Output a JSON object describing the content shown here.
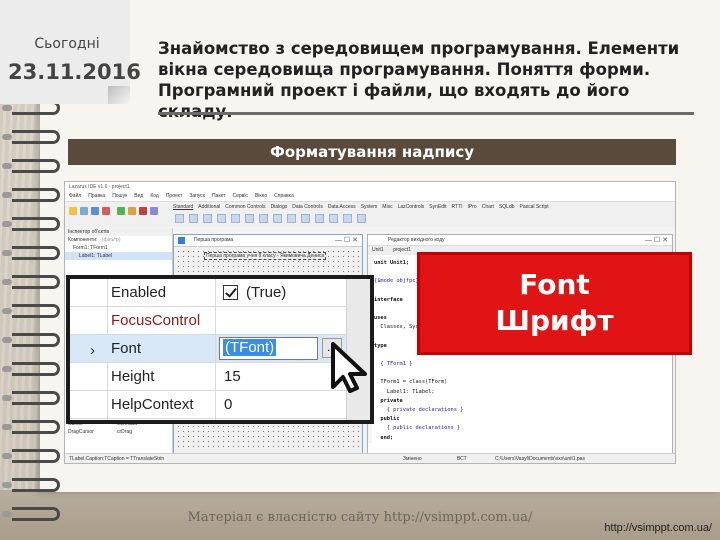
{
  "slide": {
    "today_label": "Сьогодні",
    "date": "23.11.2016",
    "heading": "Знайомство з середовищем програмування. Елементи вікна середовища програмування. Поняття форми. Програмний проект і файли, що входять до його складу.",
    "banner": "Форматування надпису",
    "callout_line1": "Font",
    "callout_line2": "Шрифт",
    "watermark": "Матеріал є власністю сайту http://vsimppt.com.ua/",
    "site_url": "http://vsimppt.com.ua/"
  },
  "ide": {
    "title": "Lazarus IDE v1.6 - project1",
    "menu": [
      "Файл",
      "Правка",
      "Пошук",
      "Вид",
      "Код",
      "Проект",
      "Запуск",
      "Пакет",
      "Сервіс",
      "Вікно",
      "Справка"
    ],
    "component_tabs": [
      "Standard",
      "Additional",
      "Common Controls",
      "Dialogs",
      "Data Controls",
      "Data Access",
      "System",
      "Misc",
      "LazControls",
      "SynEdit",
      "RTTI",
      "IPro",
      "Chart",
      "SQLdb",
      "Pascal Script"
    ],
    "inspector": {
      "title": "Інспектор об'єктів",
      "filter_label": "Компоненти:",
      "filter_placeholder": "(фільтр)",
      "tree": [
        "Form1: TForm1",
        "Label1: TLabel"
      ],
      "bottom_rows": [
        {
          "name": "Cursor",
          "value": "crDefault"
        },
        {
          "name": "DragCursor",
          "value": "crDrag"
        }
      ]
    },
    "form": {
      "title": "Перша програма",
      "label_text": "Перша програма учня 8 класу - Якимовича Дениса"
    },
    "editor": {
      "title": "Редактор вихідного коду",
      "tab": "Unit1",
      "tab_project": "project1",
      "code": [
        {
          "t": "unit Unit1;",
          "k": "kw"
        },
        {
          "t": "",
          "k": ""
        },
        {
          "t": "{$mode objfpc}{$H+}",
          "k": "cm"
        },
        {
          "t": "",
          "k": ""
        },
        {
          "t": "interface",
          "k": "kw"
        },
        {
          "t": "",
          "k": ""
        },
        {
          "t": "uses",
          "k": "kw"
        },
        {
          "t": "  Classes, SysUtils, FileUtil, Forms, Controls, Graphics, Dialogs, StdCtrls;",
          "k": ""
        },
        {
          "t": "",
          "k": ""
        },
        {
          "t": "type",
          "k": "kw"
        },
        {
          "t": "",
          "k": ""
        },
        {
          "t": "  { TForm1 }",
          "k": "cm"
        },
        {
          "t": "",
          "k": ""
        },
        {
          "t": "  TForm1 = class(TForm)",
          "k": ""
        },
        {
          "t": "    Label1: TLabel;",
          "k": ""
        },
        {
          "t": "  private",
          "k": "kw"
        },
        {
          "t": "    { private declarations }",
          "k": "cm"
        },
        {
          "t": "  public",
          "k": "kw"
        },
        {
          "t": "    { public declarations }",
          "k": "cm"
        },
        {
          "t": "  end;",
          "k": "kw"
        },
        {
          "t": "",
          "k": ""
        },
        {
          "t": "var",
          "k": "kw"
        },
        {
          "t": "  Form1: TForm1;",
          "k": ""
        }
      ]
    },
    "status": {
      "left": "TLabel.Caption:TCaption = TTranslateStrin",
      "mid1": "Змінено",
      "mid2": "ВСТ",
      "path": "C:\\Users\\Vasyl\\Documents\\xxx\\unit1.pas"
    }
  },
  "zoom_inspector": {
    "rows": [
      {
        "name": "Enabled",
        "value": "(True)",
        "type": "checkbox",
        "checked": true
      },
      {
        "name": "FocusControl",
        "value": "",
        "type": "empty",
        "name_color": "#8b1c1c"
      },
      {
        "name": "Font",
        "value": "(TFont)",
        "type": "editing",
        "selected": true
      },
      {
        "name": "Height",
        "value": "15",
        "type": "text"
      },
      {
        "name": "HelpContext",
        "value": "0",
        "type": "text"
      }
    ],
    "ellipsis": "...",
    "expand_arrow": "›"
  }
}
